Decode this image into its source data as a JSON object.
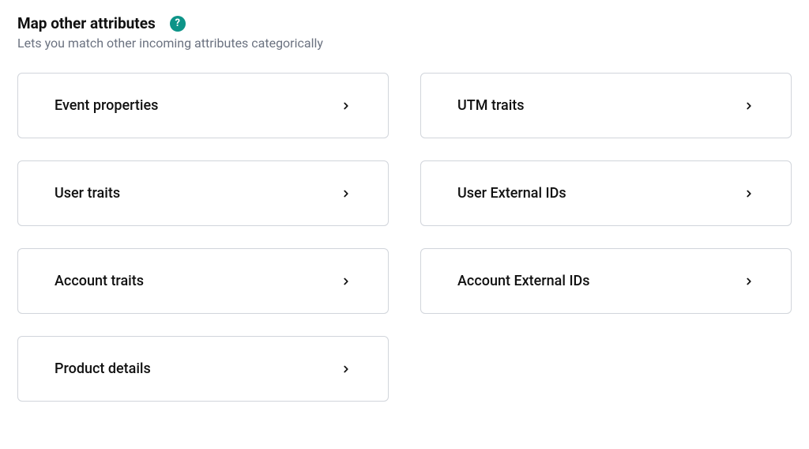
{
  "header": {
    "title": "Map other attributes",
    "subtitle": "Lets you match other incoming attributes categorically",
    "help_glyph": "?"
  },
  "cards": [
    {
      "label": "Event properties"
    },
    {
      "label": "UTM traits"
    },
    {
      "label": "User traits"
    },
    {
      "label": "User External IDs"
    },
    {
      "label": "Account traits"
    },
    {
      "label": "Account External IDs"
    },
    {
      "label": "Product details"
    }
  ]
}
